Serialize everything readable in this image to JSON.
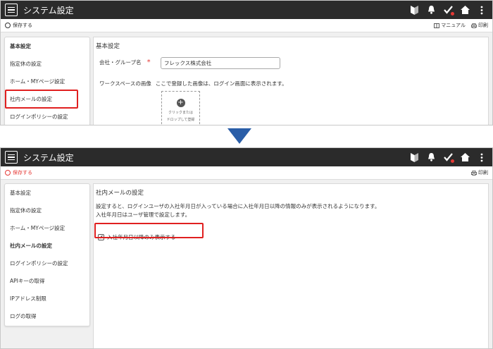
{
  "app": {
    "title": "システム設定"
  },
  "top": {
    "save_label": "保存する",
    "manual_label": "マニュアル",
    "print_label": "印刷",
    "sidebar": [
      {
        "label": "基本設定",
        "active": true
      },
      {
        "label": "指定休の設定"
      },
      {
        "label": "ホーム・MYページ設定"
      },
      {
        "label": "社内メールの設定"
      },
      {
        "label": "ログインポリシーの設定"
      }
    ],
    "section_title": "基本設定",
    "company_label": "会社・グループ名",
    "required_mark": "*",
    "company_value": "フレックス株式会社",
    "workspace_label": "ワークスペースの画像",
    "workspace_note": "ここで登録した画像は、ログイン画面に表示されます。",
    "drop_line1": "クリックまたは",
    "drop_line2": "ドロップして登録"
  },
  "bottom": {
    "save_label": "保存する",
    "print_label": "印刷",
    "sidebar": [
      {
        "label": "基本設定"
      },
      {
        "label": "指定休の設定"
      },
      {
        "label": "ホーム・MYページ設定"
      },
      {
        "label": "社内メールの設定",
        "active": true
      },
      {
        "label": "ログインポリシーの設定"
      },
      {
        "label": "APIキーの取得"
      },
      {
        "label": "IPアドレス制限"
      },
      {
        "label": "ログの取得"
      }
    ],
    "section_title": "社内メールの設定",
    "desc_line1": "設定すると、ログインユーザの入社年月日が入っている場合に入社年月日以降の情報のみが表示されるようになります。",
    "desc_line2": "入社年月日はユーザ管理で設定します。",
    "checkbox_label": "入社年月日以降のみ表示する",
    "checkbox_checked": true
  },
  "colors": {
    "titlebar": "#2b2b2b",
    "highlight": "#e02020",
    "arrow": "#2a5ea8",
    "save_red": "#e53935"
  }
}
